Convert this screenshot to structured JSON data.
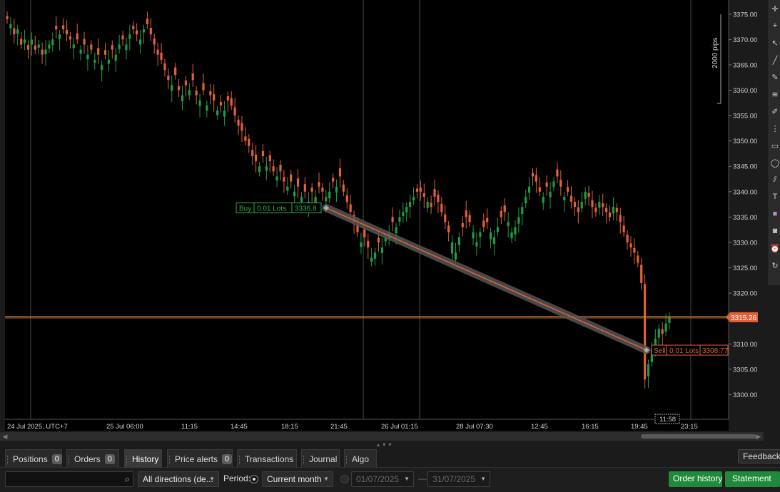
{
  "chart_data": {
    "type": "candlestick",
    "symbol_timezone_label": "24 Jul 2025, UTC+7",
    "ylim": [
      3298.0,
      3377.5
    ],
    "y_ticks": [
      "3375.00",
      "3370.00",
      "3365.00",
      "3360.00",
      "3355.00",
      "3350.00",
      "3345.00",
      "3340.00",
      "3335.00",
      "3330.00",
      "3325.00",
      "3320.00",
      "3315.00",
      "3310.00",
      "3305.00",
      "3300.00"
    ],
    "x_tick_labels": [
      "24 Jul 2025, UTC+7",
      "25 Jul 06:00",
      "11:15",
      "14:45",
      "18:15",
      "21:45",
      "26 Jul 01:15",
      "28 Jul 07:30",
      "12:45",
      "16:15",
      "19:45",
      "23:15"
    ],
    "current_price": "3315.26",
    "current_time": "11:58",
    "pips_label": "2000 pips",
    "trade": {
      "buy_label": "Buy",
      "buy_lots": "0.01 Lots",
      "buy_price": "3336.8",
      "sell_label": "Sell",
      "sell_lots": "0.01 Lots",
      "sell_price": "3308.77",
      "entry_price": 3336.8,
      "exit_price": 3308.77
    },
    "candles_close": [
      3374,
      3373,
      3371,
      3372,
      3369,
      3370,
      3368,
      3370,
      3368,
      3369,
      3367,
      3368,
      3369,
      3370,
      3372,
      3371,
      3372,
      3371,
      3370,
      3369,
      3370,
      3368,
      3369,
      3367,
      3368,
      3366,
      3367,
      3365,
      3367,
      3366,
      3368,
      3367,
      3369,
      3370,
      3369,
      3371,
      3372,
      3371,
      3370,
      3372,
      3373,
      3371,
      3369,
      3367,
      3366,
      3364,
      3362,
      3361,
      3363,
      3360,
      3359,
      3361,
      3360,
      3362,
      3359,
      3358,
      3360,
      3357,
      3359,
      3358,
      3356,
      3357,
      3356,
      3358,
      3357,
      3355,
      3353,
      3352,
      3350,
      3349,
      3347,
      3346,
      3345,
      3347,
      3345,
      3346,
      3344,
      3343,
      3344,
      3342,
      3341,
      3342,
      3340,
      3341,
      3339,
      3340,
      3338,
      3340,
      3339,
      3341,
      3340,
      3339,
      3340,
      3342,
      3341,
      3343,
      3340,
      3338,
      3336,
      3334,
      3332,
      3330,
      3331,
      3329,
      3327,
      3328,
      3330,
      3329,
      3331,
      3332,
      3334,
      3333,
      3335,
      3336,
      3337,
      3338,
      3339,
      3340,
      3340,
      3339,
      3338,
      3337,
      3339,
      3338,
      3336,
      3334,
      3332,
      3330,
      3328,
      3331,
      3333,
      3335,
      3334,
      3332,
      3330,
      3332,
      3333,
      3334,
      3332,
      3331,
      3333,
      3335,
      3336,
      3334,
      3332,
      3333,
      3335,
      3337,
      3339,
      3341,
      3343,
      3342,
      3340,
      3339,
      3341,
      3340,
      3342,
      3343,
      3341,
      3339,
      3340,
      3338,
      3337,
      3336,
      3338,
      3340,
      3339,
      3337,
      3336,
      3338,
      3337,
      3336,
      3335,
      3337,
      3336,
      3334,
      3332,
      3330,
      3329,
      3328,
      3326,
      3322,
      3303,
      3306,
      3309,
      3311,
      3313,
      3312,
      3314,
      3315.26
    ],
    "candles_open_offset": [
      0.6,
      -0.8,
      1.2,
      -0.9,
      1.1,
      -0.7,
      0.9,
      -1.0,
      0.8,
      -0.6,
      1.0,
      -0.9,
      -0.8,
      -1.1,
      0.7,
      -0.9,
      0.8,
      0.9,
      0.6,
      -0.7,
      1.2,
      -0.8,
      1.1,
      -0.9,
      1.0,
      -0.6,
      1.3,
      -1.0,
      0.9,
      -0.8,
      0.9,
      -1.2,
      -0.9,
      0.8,
      -1.1,
      -0.9,
      0.7,
      0.8,
      -1.0,
      -0.6,
      1.1,
      1.3,
      1.2,
      1.0,
      1.4,
      1.3,
      0.9,
      -1.1,
      1.5,
      0.8,
      -1.2,
      0.9,
      -1.0,
      1.3,
      0.9,
      -1.1,
      1.4,
      -1.0,
      0.8,
      1.2,
      -0.9,
      0.7,
      -1.2,
      0.8,
      1.4,
      1.6,
      1.2,
      1.5,
      0.9,
      1.4,
      1.2,
      1.3,
      -1.1,
      1.0,
      -0.9,
      1.2,
      1.0,
      -0.8,
      1.3,
      0.9,
      -0.8,
      1.4,
      -0.9,
      1.6,
      -1.0,
      1.5,
      -1.2,
      0.8,
      -1.1,
      0.9,
      0.8,
      -0.9,
      -1.3,
      0.7,
      -1.2,
      1.6,
      1.4,
      1.3,
      1.5,
      1.4,
      1.6,
      -0.9,
      1.5,
      1.3,
      -0.8,
      -1.2,
      0.9,
      -1.1,
      -0.8,
      -1.3,
      1.0,
      -1.2,
      -0.9,
      -0.8,
      -1.1,
      -1.0,
      -0.7,
      0.6,
      0.8,
      0.7,
      -1.2,
      0.8,
      1.5,
      1.4,
      1.6,
      1.5,
      1.3,
      -2.2,
      -1.4,
      -1.5,
      0.8,
      1.3,
      1.4,
      -1.2,
      -0.8,
      -0.9,
      1.3,
      0.8,
      -1.4,
      -1.3,
      -0.9,
      1.2,
      1.3,
      -0.8,
      -1.2,
      -1.4,
      -1.3,
      -1.4,
      -1.3,
      -1.2,
      0.7,
      1.3,
      0.9,
      -1.2,
      0.8,
      -1.1,
      -1.0,
      1.4,
      1.3,
      -0.7,
      0.9,
      1.2,
      1.0,
      0.9,
      -1.3,
      -1.4,
      0.7,
      1.3,
      0.8,
      -1.2,
      0.7,
      0.8,
      0.9,
      -1.3,
      0.8,
      1.4,
      1.3,
      1.5,
      0.8,
      0.9,
      1.4,
      3.6,
      18.8,
      -2.4,
      -2.6,
      -2.1,
      -1.8,
      0.9,
      -1.6,
      -1.1
    ]
  },
  "toolbar": {
    "icons": [
      "crosshair-icon",
      "plus-icon",
      "cursor-icon",
      "line-icon",
      "pencil-icon",
      "fibonacci-icon",
      "brush-icon",
      "grid-icon",
      "rectangle-icon",
      "ellipse-icon",
      "channel-icon",
      "text-icon",
      "color-swatch-icon",
      "camera-icon",
      "alarm-icon",
      "refresh-icon"
    ]
  },
  "tabs": [
    {
      "label": "Positions",
      "badge": "0"
    },
    {
      "label": "Orders",
      "badge": "0"
    },
    {
      "label": "History",
      "badge": ""
    },
    {
      "label": "Price alerts",
      "badge": "0"
    },
    {
      "label": "Transactions",
      "badge": ""
    },
    {
      "label": "Journal",
      "badge": ""
    },
    {
      "label": "Algo",
      "badge": ""
    }
  ],
  "feedback_label": "Feedback",
  "filters": {
    "search_placeholder": "",
    "direction": "All directions (de...",
    "period_label": "Period:",
    "period_value": "Current month",
    "date_from": "01/07/2025",
    "date_to": "31/07/2025",
    "dash": "—",
    "order_history": "Order history",
    "statement": "Statement"
  },
  "colors": {
    "bull": "#1f9d45",
    "bear": "#e2603a",
    "price_line": "#e2603a",
    "grid": "#4a4a4a",
    "buy_box": "#2fae4b",
    "sell_box": "#e2603a"
  }
}
